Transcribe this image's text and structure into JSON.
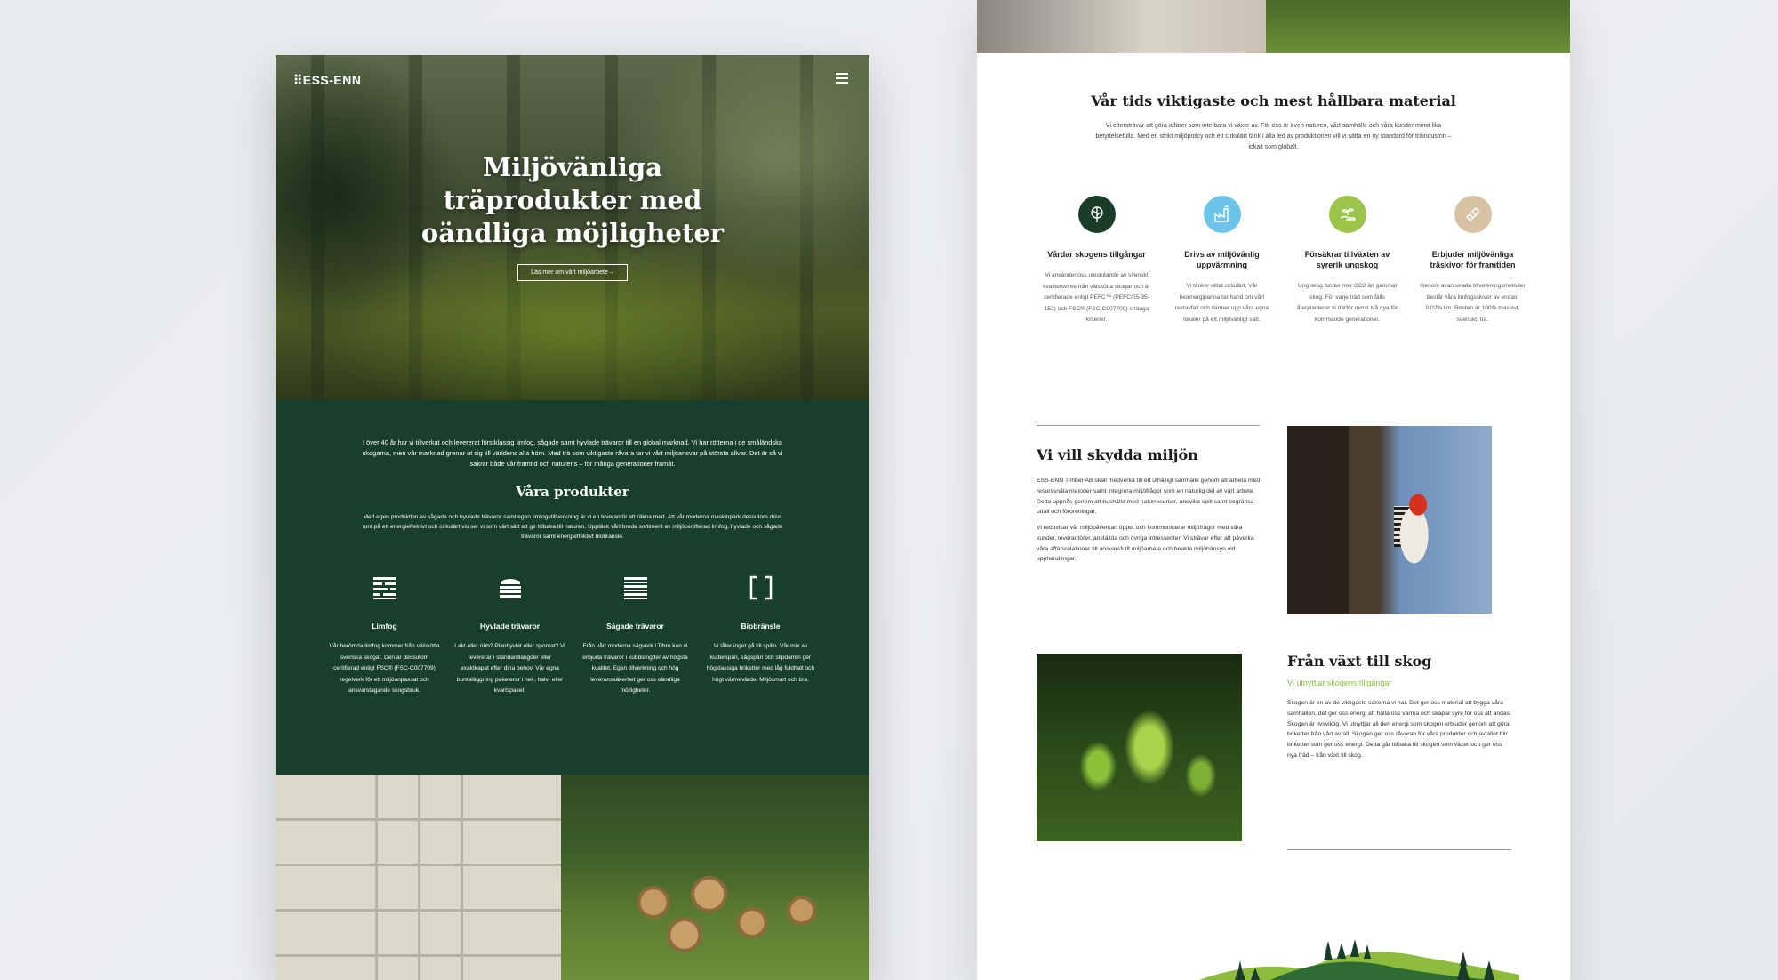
{
  "left": {
    "logo": "⠿ESS-ENN",
    "hero_title_lines": [
      "Miljövänliga",
      "träprodukter med",
      "oändliga möjligheter"
    ],
    "hero_button": "Läs mer om vårt miljöarbete→",
    "intro": "I över 40 år har vi tillverkat och levererat förstklassig limfog, sågade samt hyvlade trävaror till en global marknad. Vi har rötterna i de småländska skogarna, men vår marknad grenar ut sig till världens alla hörn. Med trä som viktigaste råvara tar vi vårt miljöansvar på största allvar. Det är så vi säkrar både vår framtid och naturens – för många generationer framåt.",
    "products_title": "Våra produkter",
    "products_sub": "Med egen produktion av sågade och hyvlade trävaror samt egen limfogstillverkning är vi en leverantör att räkna med. Att vår moderna maskinpark dessutom drivs runt på ett energieffektivt och cirkulärt vis ser vi som värt sätt att ge tillbaka till naturen. Upptäck vårt breda sortiment av miljöcertifierad limfog, hyvlade och sågade trävaror samt energieffektivt biobränsle.",
    "products": [
      {
        "icon": "limfog-icon",
        "name": "Limfog",
        "desc": "Vår berömda limfog kommer från välskötta svenska skogar. Den är dessutom certifierad enligt FSC® (FSC-C007709) regelverk för ett miljöanpassat och ansvarstagande skogsbruk."
      },
      {
        "icon": "hyvlade-icon",
        "name": "Hyvlade trävaror",
        "desc": "Lakt eller ribb? Planhyvlat eller spontat? Vi levererar i standardlängder eller exaktkapat efter dina behov. Vår egna buntaläggning paketerar i hel-, halv- eller kvartspaket."
      },
      {
        "icon": "sagade-icon",
        "name": "Sågade trävaror",
        "desc": "Från vårt moderna sågverk i Tibro kan vi erbjuda trävaror i kubblängder av högsta kvalitet. Egen tillverkning och hög leveranssäkerhet ger oss oändliga möjligheter."
      },
      {
        "icon": "biobransle-icon",
        "name": "Biobränsle",
        "desc": "Vi låter inget gå till spillo. Vår mix av kutterspån, sågspån och slipdamm ger högklassiga briketter med låg fukthalt och högt värmevärde. Miljösmart och bra."
      }
    ]
  },
  "right": {
    "title": "Vår tids viktigaste och mest hållbara material",
    "intro": "Vi eftersträvar att göra affärer som inte bara vi växer av. För oss är även naturen, vårt samhälle och våra kunder minst lika betydelsefulla. Med en strikt miljöpolicy och ett cirkulärt tänk i alla led av produktionen vill vi sätta en ny standard för träindustrin – lokalt som globalt.",
    "features": [
      {
        "icon": "tree-icon",
        "color": "#1a3d29",
        "name": "Vårdar skogens tillgångar",
        "desc": "Vi använder oss uteslutande av svenskt kvalitetsvirke från välskötta skogar och är certifierade enligt PEFC™ (PEFC/05-35-152) och FSC® (FSC-C007709) stränga kriterier."
      },
      {
        "icon": "factory-icon",
        "color": "#6cc4e8",
        "name": "Drivs av miljövänlig uppvärmning",
        "desc": "Vi tänker alltid cirkulärt. Vår bioenergipanna tar hand om vårt restavfall och värmer upp våra egna lokaler på ett miljövänligt sätt."
      },
      {
        "icon": "sprout-hand-icon",
        "color": "#9cc44a",
        "name": "Försäkrar tillväxten av syrerik ungskog",
        "desc": "Ung skog binder mer CO2 än gammal skog. För varje träd som fälls återplanterar vi därför minst två nya för kommande generationer."
      },
      {
        "icon": "board-icon",
        "color": "#d6c3a3",
        "name": "Erbjuder miljövänliga träskivor för framtiden",
        "desc": "Genom avancerade tillverkningsmetoder består våra limfogsskivor av endast 0,02% lim. Resten är 100% massivt, svenskt, trä."
      }
    ],
    "protect_title": "Vi vill skydda miljön",
    "protect_p1": "ESS-ENN Timber AB skall medverka till ett uthålligt samhälle genom att arbeta med resurssnåla metoder samt integrera miljöfrågor som en naturlig del av vårt arbete. Detta uppnås genom att hushålla med naturresurser, undvika spill samt begränsa utfall och föroreningar.",
    "protect_p2": "Vi redovisar vår miljöpåverkan öppet och kommunicerar miljöfrågor med våra kunder, leverantörer, anställda och övriga intressenter. Vi strävar efter att påverka våra affärsrelationer till ansvarsfullt miljöarbete och beakta miljöhänsyn vid upphandlingar.",
    "grow_title": "Från växt till skog",
    "grow_sub": "Vi utnyttjar skogens tillgångar",
    "grow_p": "Skogen är en av de viktigaste sakerna vi har. Det ger oss material att bygga våra samhällen, det ger oss energi att hålla oss varma och skapar syre för oss att andas. Skogen är livsviktig. Vi utnyttjar all den energi som skogen erbjuder genom att göra briketter från vårt avfall. Skogen ger oss råvaran för våra produkter och avfallet blir briketter som ger oss energi. Detta går tillbaka till skogen som växer och ger oss nya träd – från växt till skog.",
    "accent_green": "#8dbb3e"
  }
}
